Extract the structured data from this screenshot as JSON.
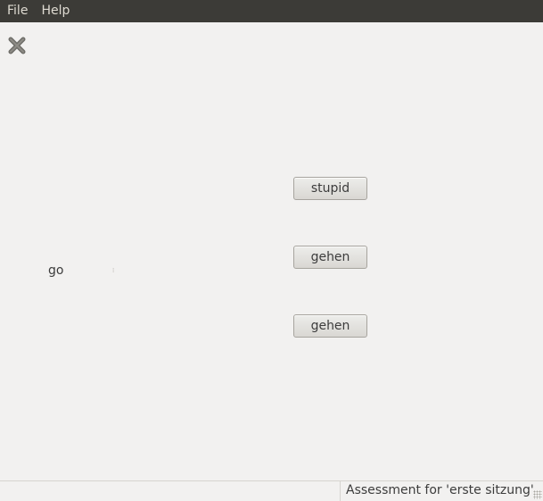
{
  "menubar": {
    "items": [
      {
        "label": "File"
      },
      {
        "label": "Help"
      }
    ]
  },
  "toolbar": {
    "close_icon": "close-x-icon"
  },
  "main": {
    "word": "go",
    "buttons": [
      {
        "label": "stupid"
      },
      {
        "label": "gehen"
      },
      {
        "label": "gehen"
      }
    ]
  },
  "statusbar": {
    "text": "Assessment for 'erste sitzung'"
  },
  "colors": {
    "menubar_bg": "#3c3b37",
    "menubar_text": "#dfdbd2",
    "window_bg": "#f2f1f0",
    "close_icon": "#6e6d68"
  }
}
